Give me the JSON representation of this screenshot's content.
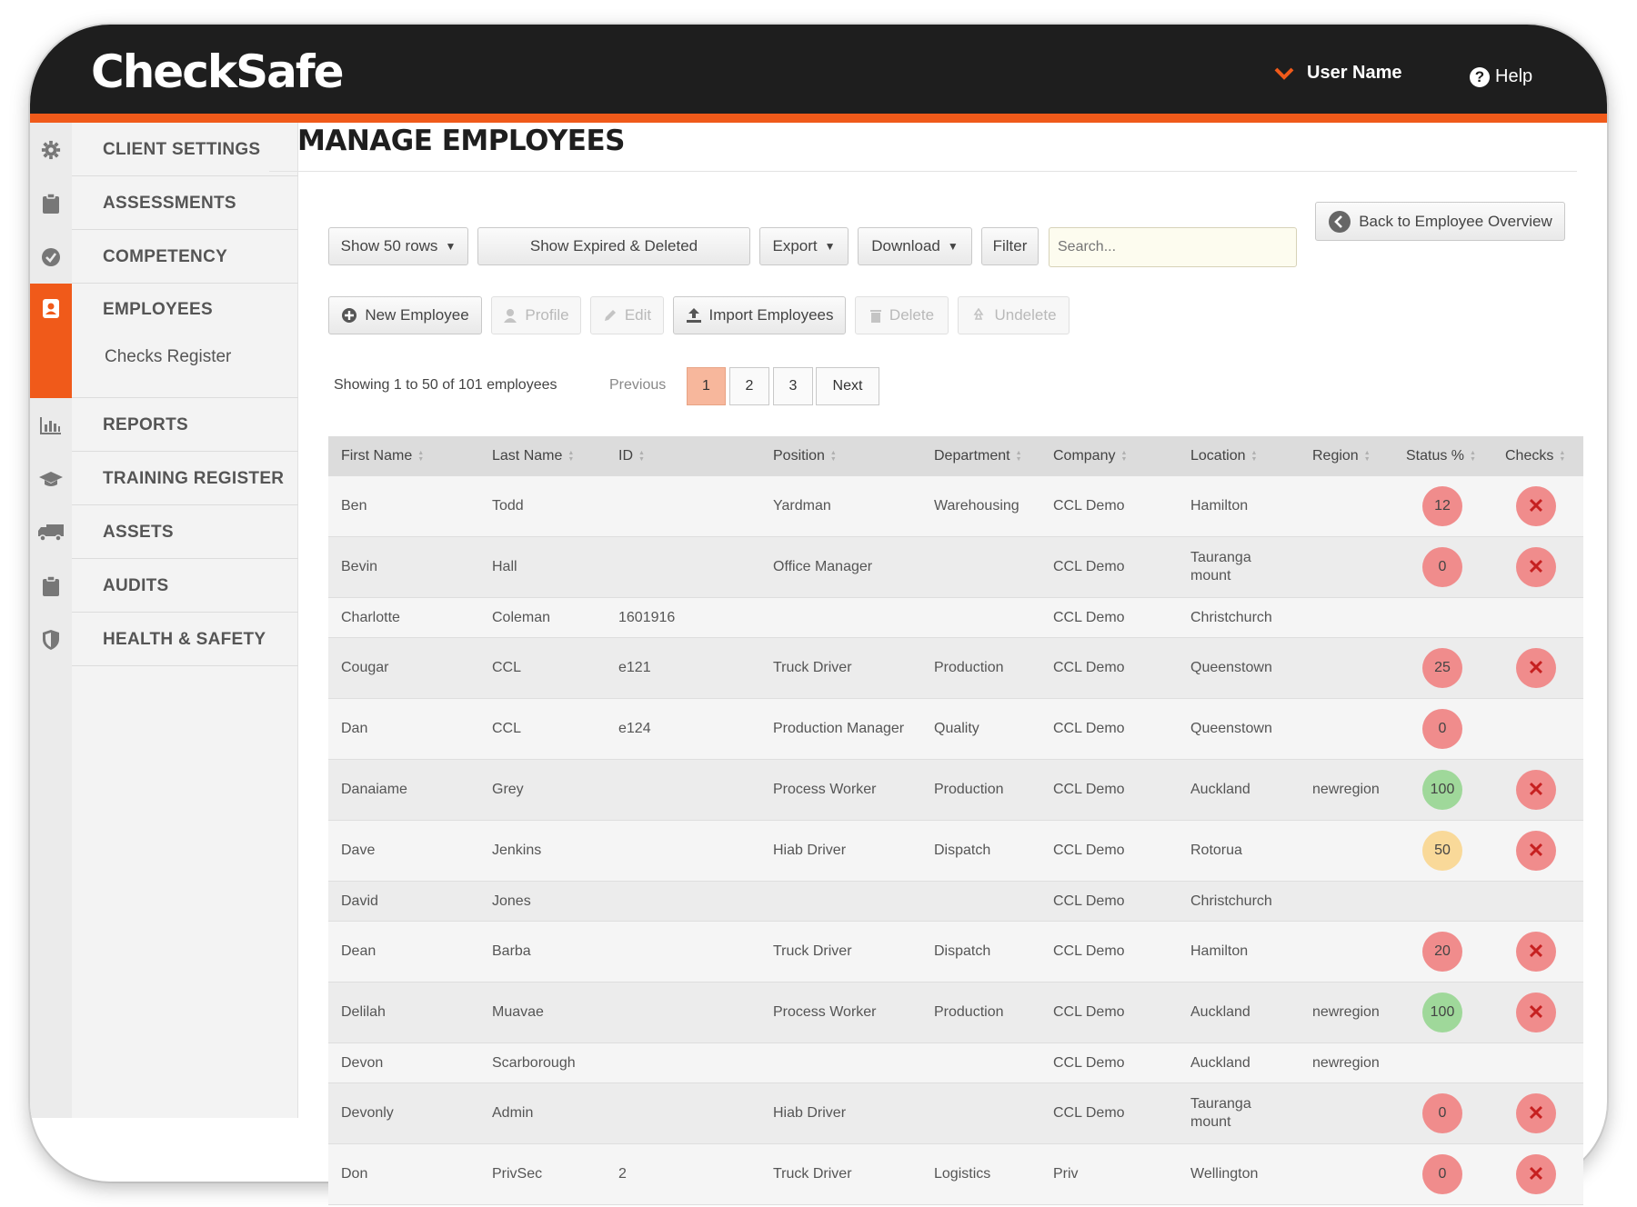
{
  "app": {
    "logo_text": "CheckSafe",
    "user_name": "User Name",
    "help_label": "Help",
    "help_glyph": "?",
    "accent_color": "#f05a1a"
  },
  "sidebar": {
    "items": [
      {
        "label": "CLIENT SETTINGS",
        "icon": "gear-icon"
      },
      {
        "label": "ASSESSMENTS",
        "icon": "clipboard-icon"
      },
      {
        "label": "COMPETENCY",
        "icon": "check-circle-icon"
      },
      {
        "label": "EMPLOYEES",
        "icon": "employee-badge-icon",
        "active": true,
        "sub": "Checks Register"
      },
      {
        "label": "REPORTS",
        "icon": "bar-chart-icon"
      },
      {
        "label": "TRAINING REGISTER",
        "icon": "graduation-cap-icon"
      },
      {
        "label": "ASSETS",
        "icon": "truck-icon"
      },
      {
        "label": "AUDITS",
        "icon": "clipboard-icon"
      },
      {
        "label": "HEALTH & SAFETY",
        "icon": "shield-icon"
      }
    ]
  },
  "main": {
    "title": "MANAGE EMPLOYEES",
    "back_button": "Back to Employee Overview",
    "toolbar": {
      "show_rows": "Show 50 rows",
      "show_expired": "Show Expired & Deleted",
      "export": "Export",
      "download": "Download",
      "filter": "Filter",
      "search_placeholder": "Search..."
    },
    "actions": {
      "new_employee": "New Employee",
      "profile": "Profile",
      "edit": "Edit",
      "import": "Import Employees",
      "delete": "Delete",
      "undelete": "Undelete"
    },
    "pagination": {
      "showing": "Showing 1 to 50 of 101 employees",
      "previous": "Previous",
      "pages": [
        "1",
        "2",
        "3"
      ],
      "current": "1",
      "next": "Next"
    },
    "table": {
      "columns": [
        "First Name",
        "Last Name",
        "ID",
        "Position",
        "Department",
        "Company",
        "Location",
        "Region",
        "Status %",
        "Checks"
      ],
      "rows": [
        {
          "first": "Ben",
          "last": "Todd",
          "id": "",
          "position": "Yardman",
          "department": "Warehousing",
          "company": "CCL Demo",
          "location": "Hamilton",
          "region": "",
          "status": "12",
          "status_color": "#f08c8c",
          "check": true
        },
        {
          "first": "Bevin",
          "last": "Hall",
          "id": "",
          "position": "Office Manager",
          "department": "",
          "company": "CCL Demo",
          "location": "Tauranga mount",
          "region": "",
          "status": "0",
          "status_color": "#f08c8c",
          "check": true
        },
        {
          "first": "Charlotte",
          "last": "Coleman",
          "id": "1601916",
          "position": "",
          "department": "",
          "company": "CCL Demo",
          "location": "Christchurch",
          "region": "",
          "status": "",
          "status_color": "",
          "check": false
        },
        {
          "first": "Cougar",
          "last": "CCL",
          "id": "e121",
          "position": "Truck Driver",
          "department": "Production",
          "company": "CCL Demo",
          "location": "Queenstown",
          "region": "",
          "status": "25",
          "status_color": "#f08c8c",
          "check": true
        },
        {
          "first": "Dan",
          "last": "CCL",
          "id": "e124",
          "position": "Production Manager",
          "department": "Quality",
          "company": "CCL Demo",
          "location": "Queenstown",
          "region": "",
          "status": "0",
          "status_color": "#f08c8c",
          "check": false
        },
        {
          "first": "Danaiame",
          "last": "Grey",
          "id": "",
          "position": "Process Worker",
          "department": "Production",
          "company": "CCL Demo",
          "location": "Auckland",
          "region": "newregion",
          "status": "100",
          "status_color": "#9fd89a",
          "check": true
        },
        {
          "first": "Dave",
          "last": "Jenkins",
          "id": "",
          "position": "Hiab Driver",
          "department": "Dispatch",
          "company": "CCL Demo",
          "location": "Rotorua",
          "region": "",
          "status": "50",
          "status_color": "#f9d999",
          "check": true
        },
        {
          "first": "David",
          "last": "Jones",
          "id": "",
          "position": "",
          "department": "",
          "company": "CCL Demo",
          "location": "Christchurch",
          "region": "",
          "status": "",
          "status_color": "",
          "check": false
        },
        {
          "first": "Dean",
          "last": "Barba",
          "id": "",
          "position": "Truck Driver",
          "department": "Dispatch",
          "company": "CCL Demo",
          "location": "Hamilton",
          "region": "",
          "status": "20",
          "status_color": "#f08c8c",
          "check": true
        },
        {
          "first": "Delilah",
          "last": "Muavae",
          "id": "",
          "position": "Process Worker",
          "department": "Production",
          "company": "CCL Demo",
          "location": "Auckland",
          "region": "newregion",
          "status": "100",
          "status_color": "#9fd89a",
          "check": true
        },
        {
          "first": "Devon",
          "last": "Scarborough",
          "id": "",
          "position": "",
          "department": "",
          "company": "CCL Demo",
          "location": "Auckland",
          "region": "newregion",
          "status": "",
          "status_color": "",
          "check": false
        },
        {
          "first": "Devonly",
          "last": "Admin",
          "id": "",
          "position": "Hiab Driver",
          "department": "",
          "company": "CCL Demo",
          "location": "Tauranga mount",
          "region": "",
          "status": "0",
          "status_color": "#f08c8c",
          "check": true
        },
        {
          "first": "Don",
          "last": "PrivSec",
          "id": "2",
          "position": "Truck Driver",
          "department": "Logistics",
          "company": "Priv",
          "location": "Wellington",
          "region": "",
          "status": "0",
          "status_color": "#f08c8c",
          "check": true
        }
      ]
    }
  }
}
